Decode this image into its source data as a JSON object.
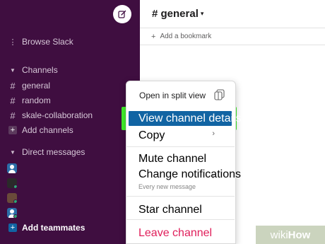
{
  "sidebar": {
    "browse_label": "Browse Slack",
    "channels_section": "Channels",
    "channels": [
      "general",
      "random",
      "skale-collaboration"
    ],
    "add_channels": "Add channels",
    "dm_section": "Direct messages",
    "add_teammates": "Add teammates",
    "background_color": "#3f0e40"
  },
  "header": {
    "channel_title": "# general",
    "bookmark_label": "Add a bookmark"
  },
  "context_menu": {
    "open_split": "Open in split view",
    "view_details": "View channel details",
    "copy": "Copy",
    "mute": "Mute channel",
    "change_notifications": "Change notifications",
    "notifications_sub": "Every new message",
    "star": "Star channel",
    "leave": "Leave channel",
    "highlight_color": "#41ee2a",
    "selected_color": "#1164a3",
    "danger_color": "#e01e5a"
  },
  "watermark": {
    "part1": "wiki",
    "part2": "How"
  }
}
